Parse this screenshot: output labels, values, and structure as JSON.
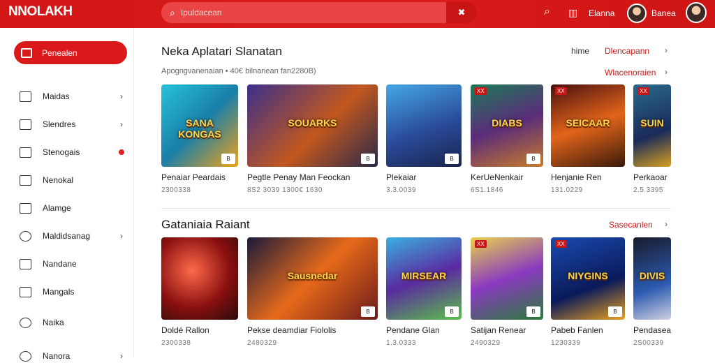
{
  "header": {
    "logo": "NNOLAKH",
    "search_placeholder": "Ipuldacean",
    "link1": "Elanna",
    "link2": "Banea"
  },
  "sidebar": {
    "active": "Penealen",
    "items": [
      {
        "label": "Maidas",
        "icon": "store-icon",
        "chev": "›"
      },
      {
        "label": "Slendres",
        "icon": "home-icon",
        "chev": "›"
      },
      {
        "label": "Stenogais",
        "icon": "window-icon",
        "dot": true
      },
      {
        "label": "Nenokal",
        "icon": "mail-icon"
      },
      {
        "label": "Alamge",
        "icon": "flag-icon"
      },
      {
        "label": "Maldidsanag",
        "icon": "gear-icon",
        "chev": "›"
      },
      {
        "label": "Nandane",
        "icon": "edit-icon"
      },
      {
        "label": "Mangals",
        "icon": "inbox-icon"
      },
      {
        "label": "Naika",
        "icon": "search-icon"
      },
      {
        "label": "Nanora",
        "icon": "clock-icon",
        "chev": "›"
      }
    ]
  },
  "section1": {
    "title": "Neka Aplatari Slanatan",
    "subtitle": "Apogngvanenaian • 40€ bilnanean fan2280B)",
    "link_plain": "hime",
    "link_red": "Dlencapann",
    "sub_link": "Wlacenoraien",
    "cards": [
      {
        "title": "Penaiar Peardais",
        "meta": "2300338",
        "label": "SANA KONGAS",
        "bg": "linear-gradient(135deg,#26c2d9,#1a7fa8 50%,#f0a21a)",
        "corner": "B"
      },
      {
        "title": "Pegtle Penay Man Feockan",
        "meta": "8S2 3039   1300€ 1630",
        "label": "SOUARKS",
        "bg": "linear-gradient(135deg,#3a2f8c,#c2571e 55%,#2a2a4a)",
        "corner": "B"
      },
      {
        "title": "Plekaiar",
        "meta": "3.3.0039",
        "label": "",
        "bg": "linear-gradient(160deg,#45a8e8,#2a4b9a 55%,#18244c)",
        "corner": "B"
      },
      {
        "title": "KerUeNenkair",
        "meta": "6S1.1846",
        "label": "DIABS",
        "bg": "linear-gradient(160deg,#1f7a5a,#5a2c7a 50%,#c97b2a)",
        "corner": "B",
        "badge": "XX"
      },
      {
        "title": "Henjanie Ren",
        "meta": "131.0229",
        "label": "SEICAAR",
        "bg": "linear-gradient(160deg,#4a1010,#e2641a 50%,#3a1a0a)",
        "badge": "XX"
      },
      {
        "title": "Perkaoar",
        "meta": "2.5.3395",
        "label": "SUIN",
        "bg": "linear-gradient(160deg,#2a6a8a,#1a2a5a 60%,#d6a020)",
        "badge": "XX"
      }
    ]
  },
  "section2": {
    "title": "Gataniaia Raiant",
    "link_red": "Sasecanlen",
    "cards": [
      {
        "title": "Doldé Rallon",
        "meta": "2300338",
        "label": "",
        "bg": "radial-gradient(circle at 40% 40%,#ff6a4a,#8a1010 55%,#2a0a0a)"
      },
      {
        "title": "Pekse deamdiar Fiololis",
        "meta": "2480329",
        "label": "Sausnedar",
        "bg": "linear-gradient(135deg,#1a1a3a,#e86a1a 50%,#6a1a1a)",
        "corner": "B"
      },
      {
        "title": "Pendane Glan",
        "meta": "1.3.0333",
        "label": "MIRSEAR",
        "bg": "linear-gradient(160deg,#3ab0e0,#5a2aa0 50%,#5ac04a)",
        "corner": "B"
      },
      {
        "title": "Satijan Renear",
        "meta": "2490329",
        "label": "",
        "bg": "linear-gradient(160deg,#e8d24a,#8a3ac0 50%,#2a7a3a)",
        "corner": "B",
        "badge": "XX"
      },
      {
        "title": "Pabeb Fanlen",
        "meta": "1230339",
        "label": "NIYGINS",
        "bg": "linear-gradient(160deg,#1a4ab0,#0a1a5a 60%,#e8a020)",
        "corner": "B",
        "badge": "XX"
      },
      {
        "title": "Pendaseare",
        "meta": "2S00339",
        "label": "DIVIS",
        "bg": "linear-gradient(160deg,#1a1a2a,#2a5ab0 60%,#d0d0e0)"
      }
    ]
  }
}
